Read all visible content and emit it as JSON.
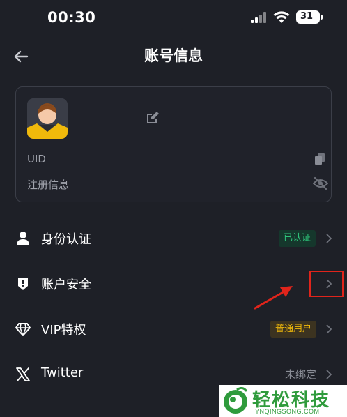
{
  "status_bar": {
    "time": "00:30",
    "battery": "31"
  },
  "header": {
    "title": "账号信息"
  },
  "profile": {
    "uid_label": "UID",
    "registration_label": "注册信息"
  },
  "menu": [
    {
      "label": "身份认证",
      "status": "已认证",
      "icon": "person-icon"
    },
    {
      "label": "账户安全",
      "status": "",
      "icon": "shield-icon"
    },
    {
      "label": "VIP特权",
      "status": "普通用户",
      "icon": "diamond-icon"
    },
    {
      "label": "Twitter",
      "status": "未绑定",
      "icon": "x-logo-icon"
    }
  ],
  "watermark": {
    "title": "轻松科技",
    "subtitle": "YNQINGSONG.COM"
  },
  "colors": {
    "background": "#1e2027",
    "verified_green": "#2ec47a",
    "vip_gold": "#f0b90b",
    "annotation_red": "#e0241b",
    "watermark_green": "#2f9b3c"
  }
}
